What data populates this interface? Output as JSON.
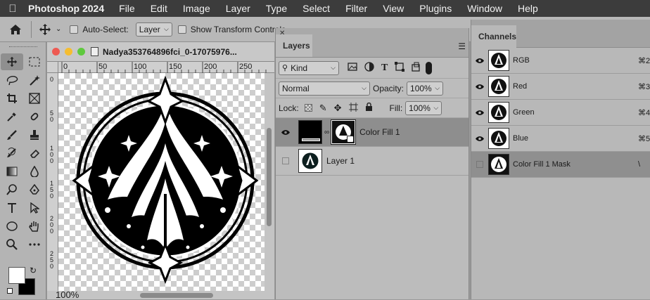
{
  "menubar": {
    "app_name": "Photoshop 2024",
    "items": [
      "File",
      "Edit",
      "Image",
      "Layer",
      "Type",
      "Select",
      "Filter",
      "View",
      "Plugins",
      "Window",
      "Help"
    ]
  },
  "options": {
    "auto_select_label": "Auto-Select:",
    "auto_select_value": "Layer",
    "show_transform_label": "Show Transform Controls"
  },
  "document": {
    "title": "Nadya353764896fci_0-17075976...",
    "ruler_ticks": [
      "0",
      "50",
      "100",
      "150",
      "200",
      "250"
    ],
    "ruler_v_ticks": [
      "0",
      "5",
      "0",
      "1",
      "0",
      "0",
      "1",
      "5",
      "0",
      "2",
      "0",
      "0",
      "2",
      "5",
      "0"
    ],
    "zoom": "100%"
  },
  "layers_panel": {
    "tab_label": "Layers",
    "filter_kind": "Kind",
    "blend_mode": "Normal",
    "opacity_label": "Opacity:",
    "opacity_value": "100%",
    "lock_label": "Lock:",
    "fill_label": "Fill:",
    "fill_value": "100%",
    "layers": [
      {
        "name": "Color Fill 1",
        "visible": true,
        "selected": true
      },
      {
        "name": "Layer 1",
        "visible": false,
        "selected": false
      }
    ]
  },
  "channels_panel": {
    "tab_label": "Channels",
    "channels": [
      {
        "name": "RGB",
        "shortcut": "⌘2",
        "visible": true
      },
      {
        "name": "Red",
        "shortcut": "⌘3",
        "visible": true
      },
      {
        "name": "Green",
        "shortcut": "⌘4",
        "visible": true
      },
      {
        "name": "Blue",
        "shortcut": "⌘5",
        "visible": true
      },
      {
        "name": "Color Fill 1 Mask",
        "shortcut": "\\",
        "visible": false
      }
    ]
  },
  "colors": {
    "menubar_bg": "#3c3c3c",
    "panel_bg": "#bcbcbc",
    "selected_layer": "#8e8e8e",
    "selected_channel": "#8f8f8f",
    "close_light": "#ee5a52",
    "minimize_light": "#f5bd30",
    "zoom_light": "#5fc93e"
  }
}
